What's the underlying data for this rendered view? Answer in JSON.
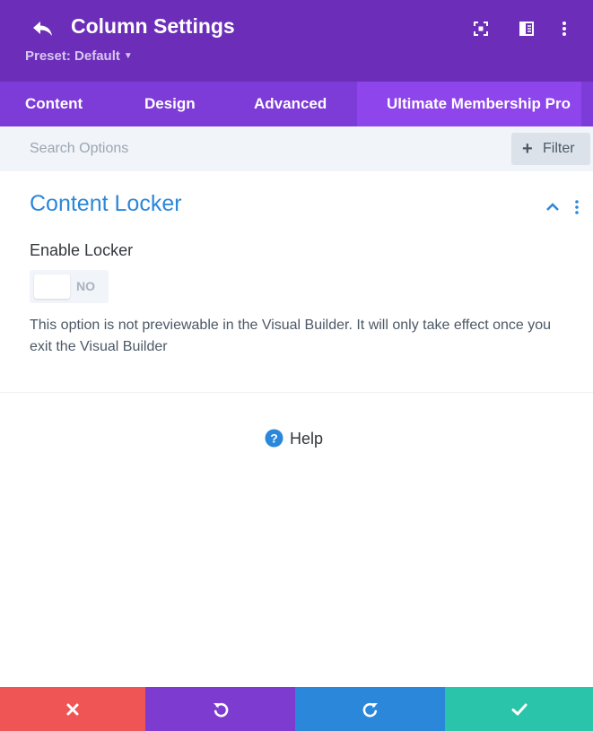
{
  "header": {
    "title": "Column Settings",
    "preset_label": "Preset: Default",
    "icons": [
      "back-icon",
      "focus-icon",
      "split-view-icon",
      "more-vertical-icon"
    ]
  },
  "tabs": [
    {
      "label": "Content",
      "active": false
    },
    {
      "label": "Design",
      "active": false
    },
    {
      "label": "Advanced",
      "active": false
    },
    {
      "label": "Ultimate Membership Pro",
      "active": true
    }
  ],
  "search": {
    "placeholder": "Search Options",
    "value": "",
    "filter_label": "Filter"
  },
  "section": {
    "title": "Content Locker",
    "expanded": true,
    "field_label": "Enable Locker",
    "toggle_value": "NO",
    "description": "This option is not previewable in the Visual Builder. It will only take effect once you exit the Visual Builder"
  },
  "help": {
    "label": "Help"
  },
  "footer": {
    "buttons": [
      {
        "name": "discard",
        "icon": "close-icon",
        "color": "#ef5555"
      },
      {
        "name": "undo",
        "icon": "undo-icon",
        "color": "#7e3bd0"
      },
      {
        "name": "redo",
        "icon": "redo-icon",
        "color": "#2b87da"
      },
      {
        "name": "save",
        "icon": "check-icon",
        "color": "#29c4a9"
      }
    ]
  },
  "colors": {
    "header_bg": "#6c2eb9",
    "tabs_bg": "#7d3bd8",
    "active_tab_bg": "#8e45ec",
    "accent_blue": "#2b87da"
  }
}
